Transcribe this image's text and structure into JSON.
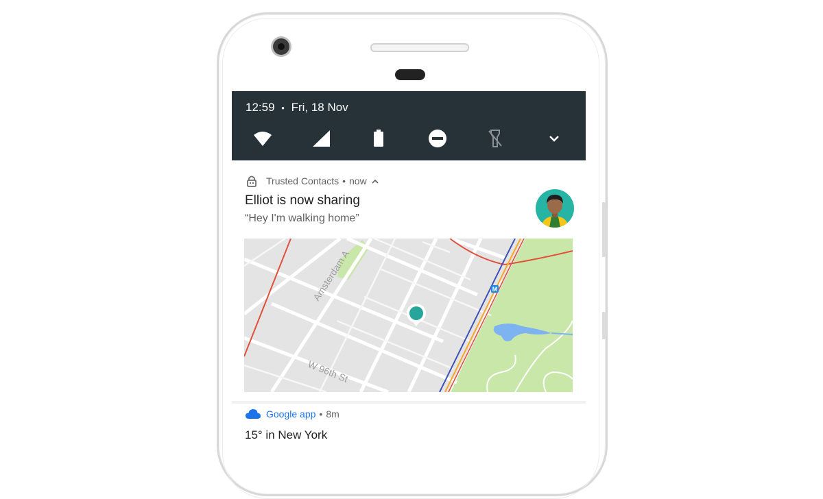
{
  "status": {
    "time": "12:59",
    "separator": "•",
    "date": "Fri, 18 Nov"
  },
  "quick_settings": {
    "icons": [
      "wifi-icon",
      "cellular-signal-icon",
      "battery-icon",
      "do-not-disturb-icon",
      "flashlight-off-icon",
      "expand-icon"
    ]
  },
  "notification": {
    "app_name": "Trusted Contacts",
    "separator": "•",
    "time": "now",
    "title": "Elliot is now sharing",
    "message": "“Hey I'm walking home”",
    "map": {
      "street_labels": [
        "Amsterdam A",
        "W 96th St"
      ],
      "marker_color": "#26a69a",
      "transit_label": "M"
    }
  },
  "notification2": {
    "app_name": "Google app",
    "separator": "•",
    "time": "8m",
    "title": "15° in New York"
  },
  "colors": {
    "quick_settings_bg": "#263238",
    "accent_blue": "#1a73e8",
    "park_green": "#c9e7a9",
    "marker_teal": "#26a69a"
  }
}
